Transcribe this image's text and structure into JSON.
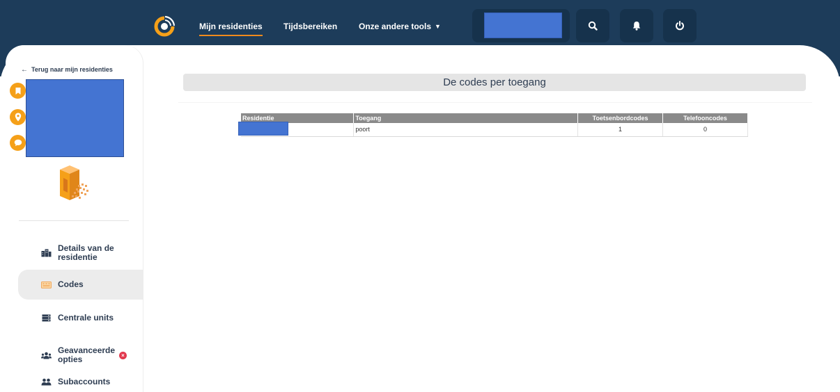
{
  "nav": {
    "links": [
      {
        "label": "Mijn residenties",
        "active": true
      },
      {
        "label": "Tijdsbereiken",
        "active": false
      },
      {
        "label": "Onze andere tools",
        "active": false
      }
    ]
  },
  "sidebar": {
    "back_label": "Terug naar mijn residenties",
    "menu": [
      {
        "label": "Details van de residentie",
        "icon": "building-icon"
      },
      {
        "label": "Codes",
        "icon": "keypad-icon",
        "active": true
      },
      {
        "label": "Centrale units",
        "icon": "server-icon"
      },
      {
        "label": "Geavanceerde opties",
        "icon": "users-cog-icon",
        "badge": "×"
      },
      {
        "label": "Subaccounts",
        "icon": "users-icon"
      }
    ]
  },
  "main": {
    "title": "De codes per toegang",
    "table": {
      "headers": [
        "Residentie",
        "Toegang",
        "Toetsenbordcodes",
        "Telefooncodes"
      ],
      "rows": [
        {
          "toegang": "poort",
          "keyboard_codes": "1",
          "phone_codes": "0"
        }
      ]
    }
  },
  "colors": {
    "topbar": "#1d3c5a",
    "accent": "#f5a019",
    "redacted": "#4474d2"
  }
}
